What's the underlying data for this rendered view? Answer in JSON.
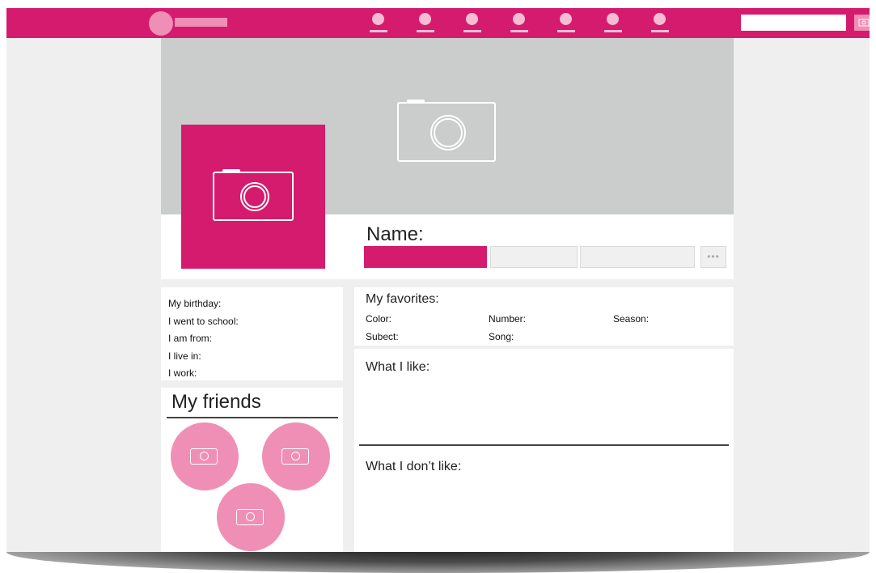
{
  "nav": {
    "items": [
      "nav-1",
      "nav-2",
      "nav-3",
      "nav-4",
      "nav-5",
      "nav-6",
      "nav-7"
    ],
    "search": {
      "placeholder": "",
      "value": ""
    }
  },
  "colors": {
    "accent": "#d41b6e",
    "accent_light": "#f08fb6",
    "cover": "#cbcdcc"
  },
  "profile": {
    "name_label": "Name:",
    "tabs": [
      "",
      "",
      ""
    ],
    "more_label": "•••"
  },
  "about": {
    "lines": [
      "My birthday:",
      "I went to school:",
      "I am from:",
      "I live in:",
      "I work:"
    ]
  },
  "friends": {
    "title": "My friends"
  },
  "favorites": {
    "title": "My favorites:",
    "items": [
      "Color:",
      "Number:",
      "Season:",
      "Subect:",
      "Song:"
    ]
  },
  "likes": {
    "title": "What I like:"
  },
  "dislikes": {
    "title": "What I don’t like:"
  },
  "icons": {
    "cover": "camera-icon",
    "avatar": "camera-icon",
    "search": "camera-icon",
    "friends": [
      "camera-icon",
      "camera-icon",
      "camera-icon"
    ]
  }
}
